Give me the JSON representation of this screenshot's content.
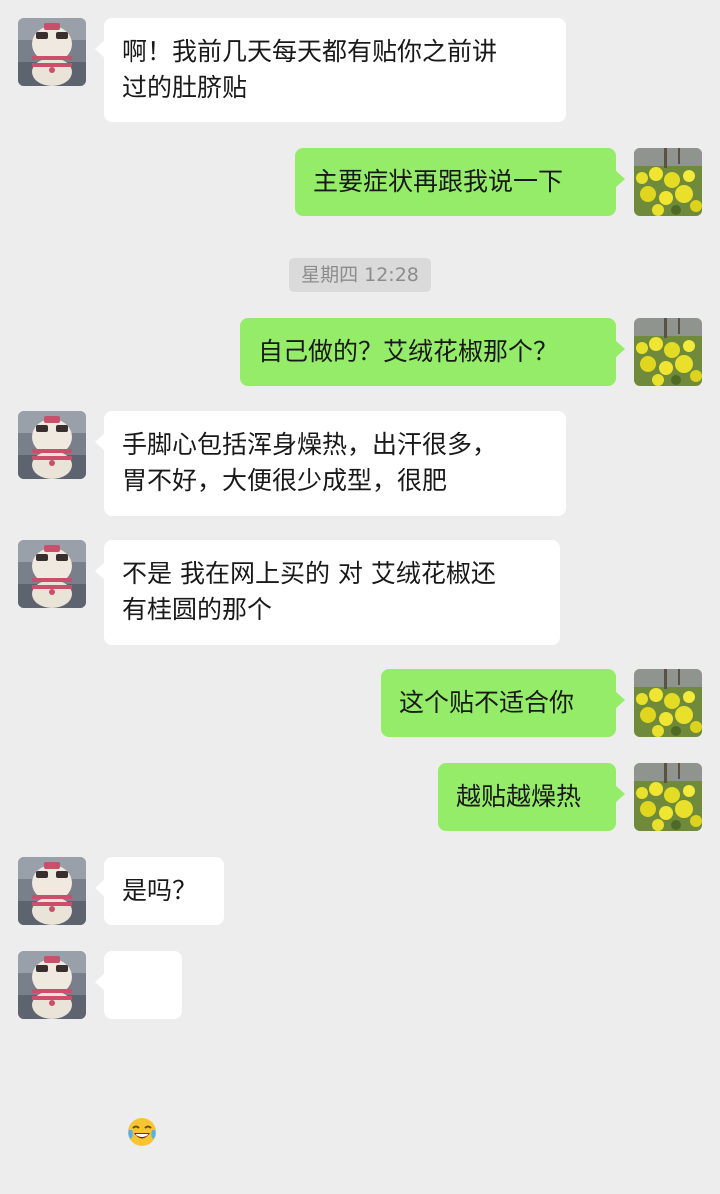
{
  "conversation": {
    "timestamp": "星期四 12:28",
    "messages": [
      {
        "side": "in",
        "text": "啊！我前几天每天都有贴你之前讲\n过的肚脐贴"
      },
      {
        "side": "out",
        "text": "主要症状再跟我说一下"
      },
      {
        "side": "out",
        "text": "自己做的？艾绒花椒那个？"
      },
      {
        "side": "in",
        "text": "手脚心包括浑身燥热，出汗很多，\n胃不好，大便很少成型，很肥"
      },
      {
        "side": "in",
        "text": "不是 我在网上买的 对 艾绒花椒还\n有桂圆的那个"
      },
      {
        "side": "out",
        "text": "这个贴不适合你"
      },
      {
        "side": "out",
        "text": "越贴越燥热"
      },
      {
        "side": "in",
        "text": "是吗？"
      },
      {
        "side": "in",
        "emoji": "face-with-tears-of-joy"
      }
    ]
  },
  "colors": {
    "background": "#ededed",
    "incoming_bubble": "#ffffff",
    "outgoing_bubble": "#95ec69",
    "timestamp_bg": "#dadada"
  },
  "icons": {
    "contact_avatar": "plush-doll-avatar-icon",
    "self_avatar": "rapeseed-flowers-avatar-icon"
  }
}
